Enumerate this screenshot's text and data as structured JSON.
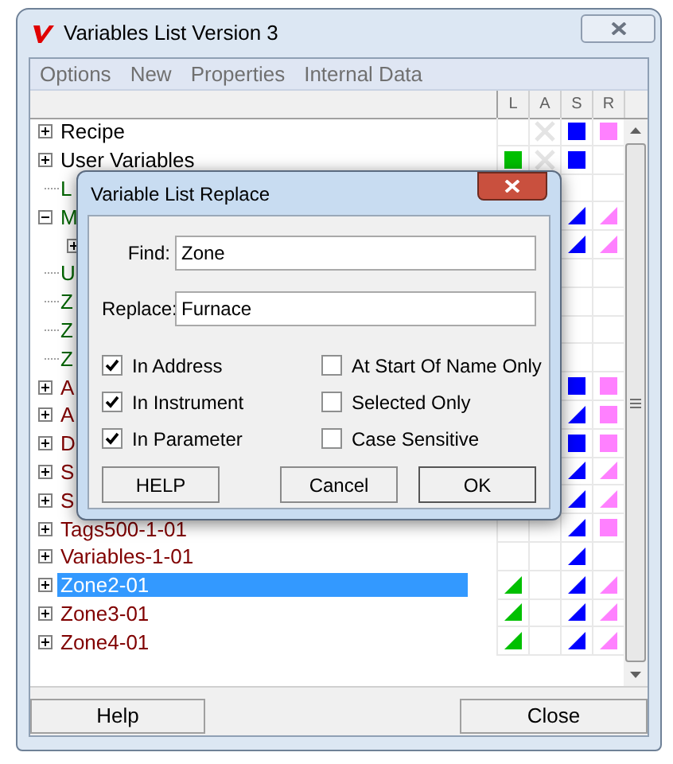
{
  "window": {
    "title": "Variables List Version 3"
  },
  "menu": [
    "Options",
    "New",
    "Properties",
    "Internal Data"
  ],
  "columns": [
    "L",
    "A",
    "S",
    "R"
  ],
  "tree": [
    {
      "label": "Recipe",
      "kind": "folder",
      "expanded": false,
      "selected": false,
      "cells": {
        "a": {
          "kind": "cross"
        },
        "s": {
          "kind": "square"
        },
        "r": {
          "kind": "square"
        }
      }
    },
    {
      "label": "User Variables",
      "kind": "folder",
      "expanded": false,
      "selected": false,
      "cells": {
        "l": {
          "kind": "square"
        },
        "a": {
          "kind": "cross"
        },
        "s": {
          "kind": "square"
        }
      }
    },
    {
      "label": "L",
      "kind": "leaf",
      "color": "#006400",
      "selected": false
    },
    {
      "label": "M",
      "kind": "folder",
      "color": "#006400",
      "expanded": true,
      "selected": false,
      "cells": {
        "s": {
          "kind": "triangle"
        },
        "r": {
          "kind": "triangle"
        }
      },
      "children": [
        {
          "kind": "folder",
          "expanded": false,
          "cells": {
            "s": {
              "kind": "triangle"
            },
            "r": {
              "kind": "triangle"
            }
          }
        }
      ]
    },
    {
      "label": "U",
      "kind": "leaf",
      "color": "#006400",
      "selected": false
    },
    {
      "label": "Z",
      "kind": "leaf",
      "color": "#006400",
      "selected": false
    },
    {
      "label": "Z",
      "kind": "leaf",
      "color": "#006400",
      "selected": false
    },
    {
      "label": "Z",
      "kind": "leaf",
      "color": "#006400",
      "selected": false
    },
    {
      "label": "A",
      "kind": "folder",
      "color": "#800000",
      "expanded": false,
      "selected": false,
      "cells": {
        "s": {
          "kind": "square"
        },
        "r": {
          "kind": "square"
        }
      }
    },
    {
      "label": "A",
      "kind": "folder",
      "color": "#800000",
      "expanded": false,
      "selected": false,
      "cells": {
        "s": {
          "kind": "triangle"
        },
        "r": {
          "kind": "square"
        }
      }
    },
    {
      "label": "D",
      "kind": "folder",
      "color": "#800000",
      "expanded": false,
      "selected": false,
      "cells": {
        "s": {
          "kind": "square"
        },
        "r": {
          "kind": "square"
        }
      }
    },
    {
      "label": "S",
      "kind": "folder",
      "color": "#800000",
      "expanded": false,
      "selected": false,
      "cells": {
        "s": {
          "kind": "triangle"
        },
        "r": {
          "kind": "triangle"
        }
      }
    },
    {
      "label": "S",
      "kind": "folder",
      "color": "#800000",
      "expanded": false,
      "selected": false,
      "cells": {
        "s": {
          "kind": "triangle"
        },
        "r": {
          "kind": "triangle"
        }
      }
    },
    {
      "label": "Tags500-1-01",
      "kind": "folder",
      "color": "#800000",
      "expanded": false,
      "selected": false,
      "cells": {
        "s": {
          "kind": "triangle"
        },
        "r": {
          "kind": "square"
        }
      }
    },
    {
      "label": "Variables-1-01",
      "kind": "folder",
      "color": "#800000",
      "expanded": false,
      "selected": false,
      "cells": {
        "s": {
          "kind": "triangle"
        }
      }
    },
    {
      "label": "Zone2-01",
      "kind": "folder",
      "expanded": false,
      "selected": true,
      "cells": {
        "l": {
          "kind": "triangle"
        },
        "s": {
          "kind": "triangle"
        },
        "r": {
          "kind": "triangle"
        }
      }
    },
    {
      "label": "Zone3-01",
      "kind": "folder",
      "color": "#800000",
      "expanded": false,
      "selected": false,
      "cells": {
        "l": {
          "kind": "triangle"
        },
        "s": {
          "kind": "triangle"
        },
        "r": {
          "kind": "triangle"
        }
      }
    },
    {
      "label": "Zone4-01",
      "kind": "folder",
      "color": "#800000",
      "expanded": false,
      "selected": false,
      "cells": {
        "l": {
          "kind": "triangle"
        },
        "s": {
          "kind": "triangle"
        },
        "r": {
          "kind": "triangle"
        }
      }
    }
  ],
  "bottom_buttons": [
    "Help",
    "Close"
  ],
  "dialog": {
    "title": "Variable List Replace",
    "find": {
      "label": "Find:",
      "value": "Zone"
    },
    "replace": {
      "label": "Replace:",
      "value": "Furnace"
    },
    "options": [
      {
        "label": "In Address",
        "checked": true
      },
      {
        "label": "At Start Of Name Only",
        "checked": false
      },
      {
        "label": "In Instrument",
        "checked": true
      },
      {
        "label": "Selected Only",
        "checked": false
      },
      {
        "label": "In Parameter",
        "checked": true
      },
      {
        "label": "Case Sensitive",
        "checked": false
      }
    ],
    "buttons": [
      "HELP",
      "Cancel",
      "OK"
    ]
  }
}
